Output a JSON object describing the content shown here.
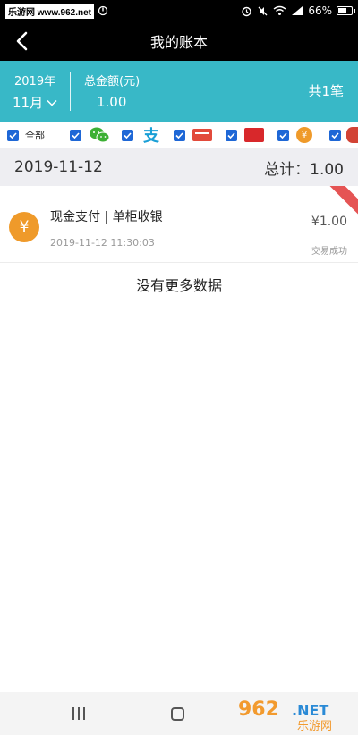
{
  "status_bar": {
    "watermark": "乐游网 www.962.net",
    "battery_percent": "66%",
    "battery_level": 0.66,
    "icons": [
      "alarm-icon",
      "mute-icon",
      "wifi-icon",
      "signal-icon",
      "battery-icon"
    ]
  },
  "header": {
    "title": "我的账本",
    "back_icon": "chevron-left-icon"
  },
  "summary": {
    "year": "2019年",
    "month": "11月",
    "total_label": "总金额(元)",
    "total_amount": "1.00",
    "count": "共1笔",
    "bg_color": "#38b8c7"
  },
  "filters": {
    "all_label": "全部",
    "items": [
      {
        "icon": "checkbox-icon",
        "checked": true
      },
      {
        "icon": "wechat-icon",
        "checked": true
      },
      {
        "icon": "alipay-icon",
        "checked": true,
        "glyph": "支"
      },
      {
        "icon": "bank-card-icon",
        "checked": true
      },
      {
        "icon": "unionpay-icon",
        "checked": true
      },
      {
        "icon": "cash-coin-icon",
        "checked": true,
        "glyph": "¥"
      },
      {
        "icon": "avatar-icon",
        "checked": true
      }
    ],
    "check_color": "#1e67d6"
  },
  "list": {
    "date": "2019-11-12",
    "daily_total": "总计：1.00",
    "transactions": [
      {
        "icon": "cash-coin-icon",
        "icon_glyph": "¥",
        "title": "现金支付 | 单柜收银",
        "time": "2019-11-12 11:30:03",
        "amount": "¥1.00",
        "status": "交易成功"
      }
    ],
    "no_more": "没有更多数据"
  },
  "watermark_logo": "962.NET 乐游网"
}
